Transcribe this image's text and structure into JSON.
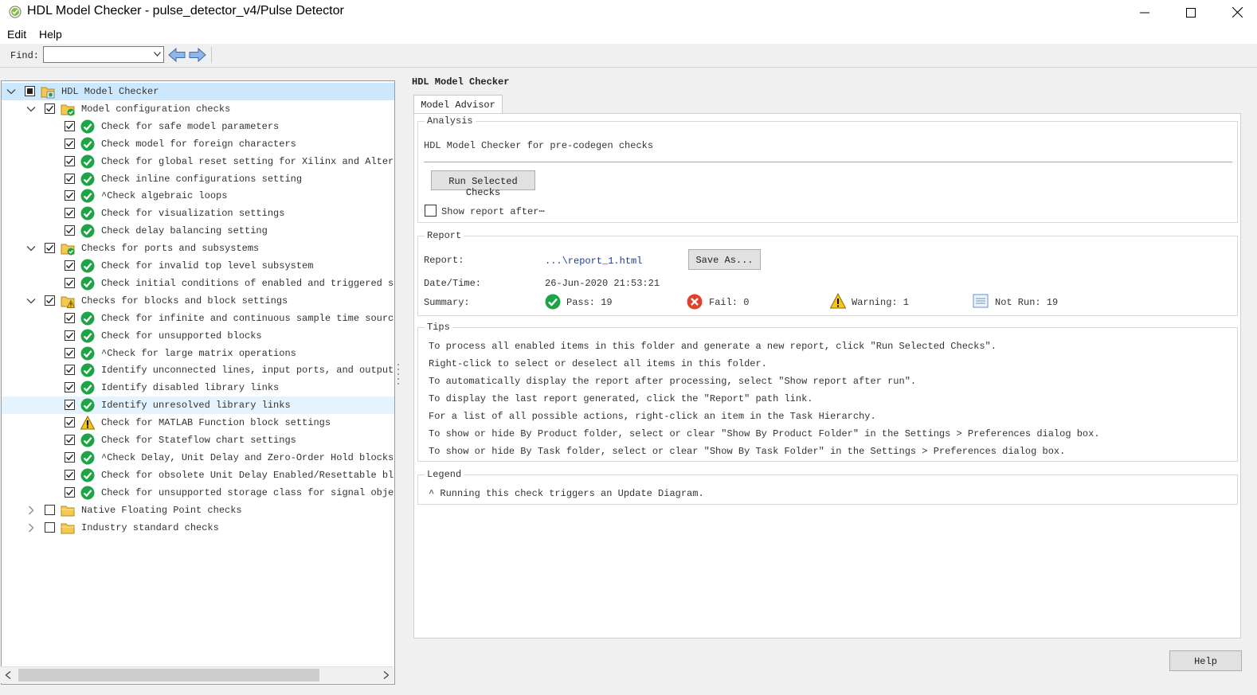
{
  "window": {
    "title": "HDL Model Checker - pulse_detector_v4/Pulse Detector",
    "controls": [
      "minimize",
      "maximize",
      "close"
    ]
  },
  "menu": {
    "items": [
      "Edit",
      "Help"
    ]
  },
  "toolbar": {
    "find_label": "Find:",
    "find_value": "",
    "back_icon": "left-arrow-icon",
    "forward_icon": "right-arrow-icon"
  },
  "tree": {
    "rows": [
      {
        "label": "HDL Model Checker",
        "level": 0,
        "expander": "expanded",
        "check": "partial",
        "icon": "hdl-checker-folder-icon"
      },
      {
        "label": "Model configuration checks",
        "level": 1,
        "expander": "expanded",
        "check": "checked",
        "icon": "folder-pass-icon"
      },
      {
        "label": "Check for safe model parameters",
        "level": 2,
        "check": "checked",
        "icon": "pass-icon"
      },
      {
        "label": "Check model for foreign characters",
        "level": 2,
        "check": "checked",
        "icon": "pass-icon"
      },
      {
        "label": "Check for global reset setting for Xilinx and Altera devi",
        "level": 2,
        "check": "checked",
        "icon": "pass-icon"
      },
      {
        "label": "Check inline configurations setting",
        "level": 2,
        "check": "checked",
        "icon": "pass-icon"
      },
      {
        "label": "^Check algebraic loops",
        "level": 2,
        "check": "checked",
        "icon": "pass-icon"
      },
      {
        "label": "Check for visualization settings",
        "level": 2,
        "check": "checked",
        "icon": "pass-icon"
      },
      {
        "label": "Check delay balancing setting",
        "level": 2,
        "check": "checked",
        "icon": "pass-icon"
      },
      {
        "label": "Checks for ports and subsystems",
        "level": 1,
        "expander": "expanded",
        "check": "checked",
        "icon": "folder-pass-icon"
      },
      {
        "label": "Check for invalid top level subsystem",
        "level": 2,
        "check": "checked",
        "icon": "pass-icon"
      },
      {
        "label": "Check initial conditions of enabled and triggered subsyst",
        "level": 2,
        "check": "checked",
        "icon": "pass-icon"
      },
      {
        "label": "Checks for blocks and block settings",
        "level": 1,
        "expander": "expanded",
        "check": "checked",
        "icon": "folder-warning-icon"
      },
      {
        "label": "Check for infinite and continuous sample time sources",
        "level": 2,
        "check": "checked",
        "icon": "pass-icon"
      },
      {
        "label": "Check for unsupported blocks",
        "level": 2,
        "check": "checked",
        "icon": "pass-icon"
      },
      {
        "label": "^Check for large matrix operations",
        "level": 2,
        "check": "checked",
        "icon": "pass-icon"
      },
      {
        "label": "Identify unconnected lines, input ports, and output ports",
        "level": 2,
        "check": "checked",
        "icon": "pass-icon"
      },
      {
        "label": "Identify disabled library links",
        "level": 2,
        "check": "checked",
        "icon": "pass-icon"
      },
      {
        "label": "Identify unresolved library links",
        "level": 2,
        "check": "checked",
        "icon": "pass-icon",
        "highlight": true
      },
      {
        "label": "Check for MATLAB Function block settings",
        "level": 2,
        "check": "checked",
        "icon": "warning-icon"
      },
      {
        "label": "Check for Stateflow chart settings",
        "level": 2,
        "check": "checked",
        "icon": "pass-icon"
      },
      {
        "label": "^Check Delay, Unit Delay and Zero-Order Hold blocks for r",
        "level": 2,
        "check": "checked",
        "icon": "pass-icon"
      },
      {
        "label": "Check for obsolete Unit Delay Enabled/Resettable blocks",
        "level": 2,
        "check": "checked",
        "icon": "pass-icon"
      },
      {
        "label": "Check for unsupported storage class for signal objects",
        "level": 2,
        "check": "checked",
        "icon": "pass-icon"
      },
      {
        "label": "Native Floating Point checks",
        "level": 1,
        "expander": "collapsed",
        "check": "unchecked",
        "icon": "folder-icon"
      },
      {
        "label": "Industry standard checks",
        "level": 1,
        "expander": "collapsed",
        "check": "unchecked",
        "icon": "folder-icon"
      }
    ]
  },
  "right": {
    "title": "HDL Model Checker",
    "tab": "Model Advisor",
    "analysis": {
      "heading": "Analysis",
      "description": "HDL Model Checker for pre-codegen checks",
      "run_button": "Run Selected Checks",
      "show_report_label": "Show report after⋯",
      "show_report_checked": false
    },
    "report": {
      "heading": "Report",
      "report_label": "Report:",
      "report_link": "...\\report_1.html",
      "save_as_button": "Save As...",
      "datetime_label": "Date/Time:",
      "datetime_value": "26-Jun-2020 21:53:21",
      "summary_label": "Summary:",
      "pass": "Pass: 19",
      "fail": "Fail: 0",
      "warning": "Warning: 1",
      "not_run": "Not Run: 19"
    },
    "tips": {
      "heading": "Tips",
      "lines": [
        "To process all enabled items in this folder and generate a new report, click \"Run Selected Checks\".",
        "Right-click to select or deselect all items in this folder.",
        "To automatically display the report after processing, select \"Show report after run\".",
        "To display the last report generated, click the \"Report\" path link.",
        "For a list of all possible actions, right-click an item in the Task Hierarchy.",
        "To show or hide By Product folder, select or clear \"Show By Product Folder\" in the Settings > Preferences dialog box.",
        "To show or hide By Task folder, select or clear \"Show By Task Folder\" in the Settings > Preferences dialog box."
      ]
    },
    "legend": {
      "heading": "Legend",
      "line": "^ Running this check triggers an Update Diagram."
    },
    "help_button": "Help"
  },
  "colors": {
    "selection": "#cce8ff",
    "pass_green": "#1ea446",
    "fail_red": "#e0412b",
    "warning_yellow": "#f5c518",
    "folder_yellow": "#f3c94f",
    "link_blue": "#1a3d9c"
  }
}
